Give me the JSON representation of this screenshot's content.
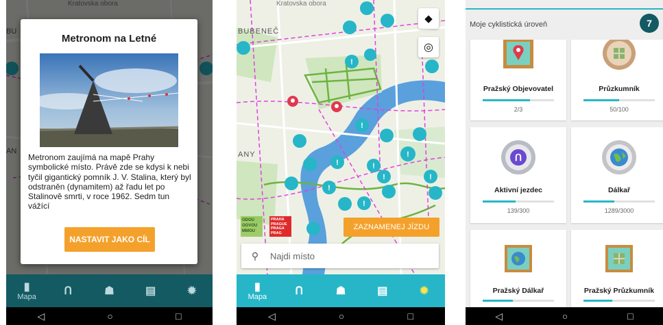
{
  "nav": {
    "items": [
      {
        "label": "Mapa",
        "icon": "map-icon"
      },
      {
        "label": "",
        "icon": "routes-icon"
      },
      {
        "label": "",
        "icon": "places-icon"
      },
      {
        "label": "",
        "icon": "list-icon"
      },
      {
        "label": "",
        "icon": "tips-icon"
      }
    ]
  },
  "map_labels": {
    "street": "Kratovska obora",
    "bubenec": "BUBENEČ",
    "left_p1": "BU",
    "left_p1_b": "AN",
    "left_p2": "ANY"
  },
  "dialog": {
    "title": "Metronom na Letné",
    "text": "Metronom zaujímá na mapě Prahy symbolické místo. Právě zde se kdysi k nebi tyčil gigantický pomník J. V. Stalina, který byl odstraněn (dynamitem) až řadu let po Stalinově smrti, v roce 1962. Sedm tun vážící",
    "button": "NASTAVIT JAKO CÍL"
  },
  "map_screen": {
    "record_button": "ZAZNAMENEJ JÍZDU",
    "search_placeholder": "Najdi místo",
    "logo1": "ODOU OOVOU MMOU",
    "logo2": "PRAHA PRAGUE PRAGA PRAG"
  },
  "level": {
    "title": "Moje cyklistická úroveň",
    "value": "7"
  },
  "achievements": [
    {
      "name": "Pražský Objevovatel",
      "progress": "2/3",
      "fraction": 0.667
    },
    {
      "name": "Průzkumník",
      "progress": "50/100",
      "fraction": 0.5
    },
    {
      "name": "Aktivní jezdec",
      "progress": "139/300",
      "fraction": 0.463
    },
    {
      "name": "Dálkař",
      "progress": "1289/3000",
      "fraction": 0.43
    },
    {
      "name": "Pražský Dálkař",
      "progress": "",
      "fraction": 0.42
    },
    {
      "name": "Pražský Průzkumník",
      "progress": "",
      "fraction": 0.4
    }
  ],
  "colors": {
    "teal": "#26b6c7",
    "dark_teal": "#145a63",
    "orange": "#f4a12c",
    "river": "#5aa0dc",
    "park": "#6db33f",
    "route": "#e040e0"
  }
}
